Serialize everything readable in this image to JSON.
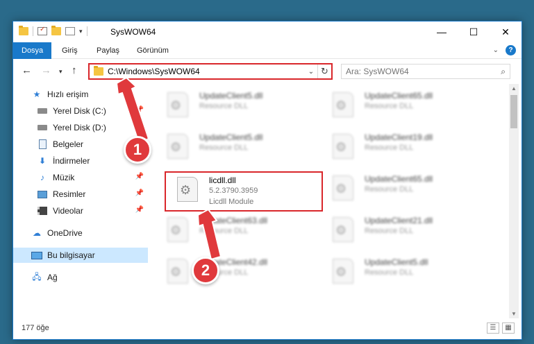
{
  "window": {
    "title": "SysWOW64"
  },
  "ribbon": {
    "tabs": [
      "Dosya",
      "Giriş",
      "Paylaş",
      "Görünüm"
    ]
  },
  "address": {
    "path": "C:\\Windows\\SysWOW64",
    "search_placeholder": "Ara: SysWOW64"
  },
  "nav": {
    "items": [
      {
        "label": "Hızlı erişim",
        "icon": "star-icon",
        "pinned": false
      },
      {
        "label": "Yerel Disk (C:)",
        "icon": "disk-icon",
        "pinned": true
      },
      {
        "label": "Yerel Disk (D:)",
        "icon": "disk-icon",
        "pinned": true
      },
      {
        "label": "Belgeler",
        "icon": "documents-icon",
        "pinned": true
      },
      {
        "label": "İndirmeler",
        "icon": "download-icon",
        "pinned": true
      },
      {
        "label": "Müzik",
        "icon": "music-icon",
        "pinned": true
      },
      {
        "label": "Resimler",
        "icon": "pictures-icon",
        "pinned": true
      },
      {
        "label": "Videolar",
        "icon": "videos-icon",
        "pinned": true
      },
      {
        "label": "OneDrive",
        "icon": "cloud-icon",
        "pinned": false
      },
      {
        "label": "Bu bilgisayar",
        "icon": "computer-icon",
        "pinned": false
      },
      {
        "label": "Ağ",
        "icon": "network-icon",
        "pinned": false
      }
    ]
  },
  "files": {
    "left": [
      {
        "name": "UpdateClient5.dll",
        "type": "Resource DLL"
      },
      {
        "name": "UpdateClient5.dll",
        "type": "Resource DLL"
      },
      {
        "name": "licdll.dll",
        "version": "5.2.3790.3959",
        "description": "Licdll Module"
      },
      {
        "name": "UpdateClient63.dll",
        "type": "Resource DLL"
      },
      {
        "name": "UpdateClient42.dll",
        "type": "Resource DLL"
      }
    ],
    "right": [
      {
        "name": "UpdateClient65.dll",
        "type": "Resource DLL"
      },
      {
        "name": "UpdateClient19.dll",
        "type": "Resource DLL"
      },
      {
        "name": "UpdateClient65.dll",
        "type": "Resource DLL"
      },
      {
        "name": "UpdateClient21.dll",
        "type": "Resource DLL"
      },
      {
        "name": "UpdateClient5.dll",
        "type": "Resource DLL"
      }
    ]
  },
  "status": {
    "count": "177 öğe"
  },
  "annotations": {
    "badge1": "1",
    "badge2": "2",
    "accent": "#e0393c"
  }
}
